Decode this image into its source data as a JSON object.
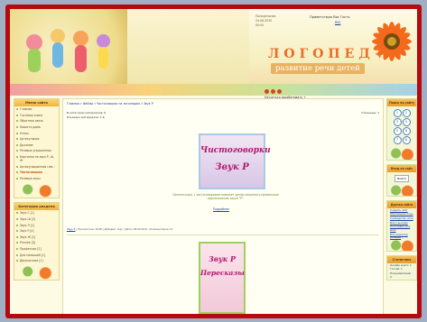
{
  "header": {
    "title": "ЛОГОПЕД",
    "title_plus": "+",
    "subtitle": "развитие речи детей",
    "greeting": "Приветствую Вас Гость",
    "rss": "RSS",
    "top_left_line1": "Понедельник",
    "top_left_line2": "24.08.2020",
    "top_left_line3": "00:05",
    "dots_label": "Научиться зарабатывать +"
  },
  "left_menu": {
    "title": "Меню сайта",
    "items": [
      "Главная",
      "Гостевая книга",
      "Обратная связь",
      "Новости дома",
      "Утеки",
      "Артикуляция",
      "Дыхание",
      "Речевые упражнения",
      "Картинки на звук Р, Ш, Ж",
      "Артикуляционная гим...",
      "Чистоговорки",
      "Речевые игры"
    ],
    "active_index": 10
  },
  "categories": {
    "title": "Категории раздела",
    "items": [
      "Звук С [1]",
      "Звук Ш [2]",
      "Звук Л [1]",
      "Звук Р [4]",
      "Звук Ж [1]",
      "Ранние [3]",
      "Профессии [2]",
      "Для малышей [1]",
      "Двуязычные [1]"
    ]
  },
  "main": {
    "breadcrumb": "Главная » Файлы » Чистоговорки на логопедию » Звук Р",
    "materials_count": "В категории материалов: 6",
    "shown_materials": "Показано материалов: 1-6",
    "pages_label": "Страницы: 1",
    "card1_line1": "Чистоговорки",
    "card1_line2": "Звук Р",
    "card1_desc": "Презентация, с чистоговорками поможет детям закрепить правильное произношение звука \"Р\".",
    "more_label": "Подробнее",
    "card1_meta_prefix": "Звук Р",
    "card1_meta_rest": " | Просмотров: 2048 | Добавил: logo | Дата: 08.09.2011 | Комментарии (2)",
    "card2_line1": "Звук Р",
    "card2_line2": "Пересказы"
  },
  "right_col": {
    "calendar_title": "Поиск по сайту",
    "calendar_marks": [
      "1",
      "2",
      "3",
      "4",
      "5",
      "6",
      "7",
      "8"
    ],
    "login_title": "Вход на сайт",
    "login_button": "Войти",
    "friends_title": "Друзья сайта",
    "friends_links": [
      "Создать сайт",
      "Обучающие игры",
      "Сообщество uCoz",
      "Всё о школах",
      "Логопедия для всех",
      "Всё развитие малыша"
    ],
    "stats_title": "Статистика",
    "stats_lines": [
      "Онлайн всего: 1",
      "Гостей: 1",
      "Пользователей: 0"
    ]
  },
  "colors": {
    "frame": "#b8090f",
    "accent": "#ee6b2a",
    "link": "#1a3fa8",
    "menu_title": "#f0b33d"
  }
}
